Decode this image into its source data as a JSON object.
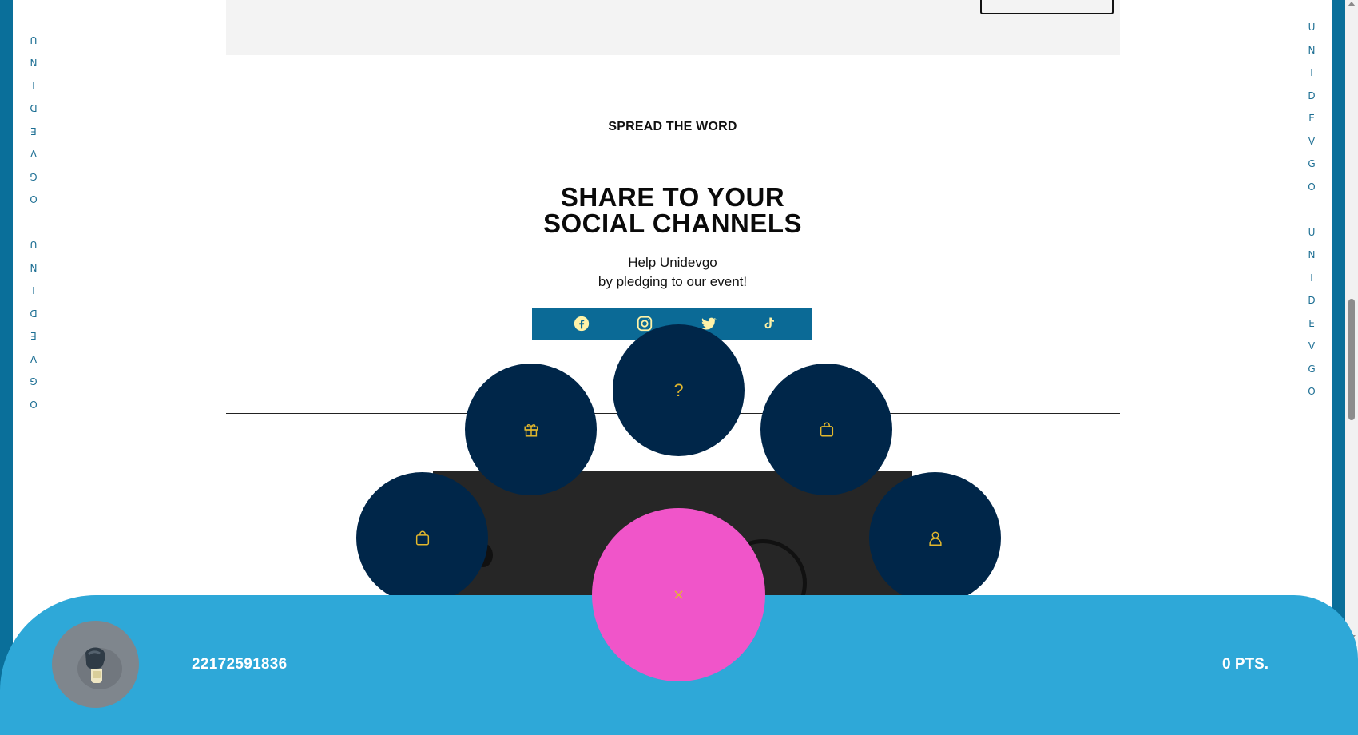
{
  "brand_vertical_text": "UNIDEVGO UNIDEVGO",
  "spread": {
    "title": "SPREAD THE WORD"
  },
  "share": {
    "title_line1": "SHARE TO YOUR",
    "title_line2": "SOCIAL CHANNELS",
    "sub_line1": "Help Unidevgo",
    "sub_line2": "by pledging to our event!"
  },
  "social": {
    "items": [
      {
        "name": "facebook-icon"
      },
      {
        "name": "instagram-icon"
      },
      {
        "name": "twitter-icon"
      },
      {
        "name": "tiktok-icon"
      }
    ],
    "icon_color": "#fff3a8",
    "bar_color": "#0b6a96"
  },
  "radial_menu": {
    "help_label": "?",
    "close_label": "×",
    "circle_color": "#002649",
    "icon_color": "#e3b82d",
    "close_color": "#f055c9",
    "items": [
      {
        "name": "help-icon"
      },
      {
        "name": "gift-icon"
      },
      {
        "name": "shopping-bag-icon"
      },
      {
        "name": "shopping-bag-icon"
      },
      {
        "name": "user-icon"
      }
    ]
  },
  "footer": {
    "user_id": "22172591836",
    "points": "0 PTS.",
    "background": "#2ea8d8"
  }
}
